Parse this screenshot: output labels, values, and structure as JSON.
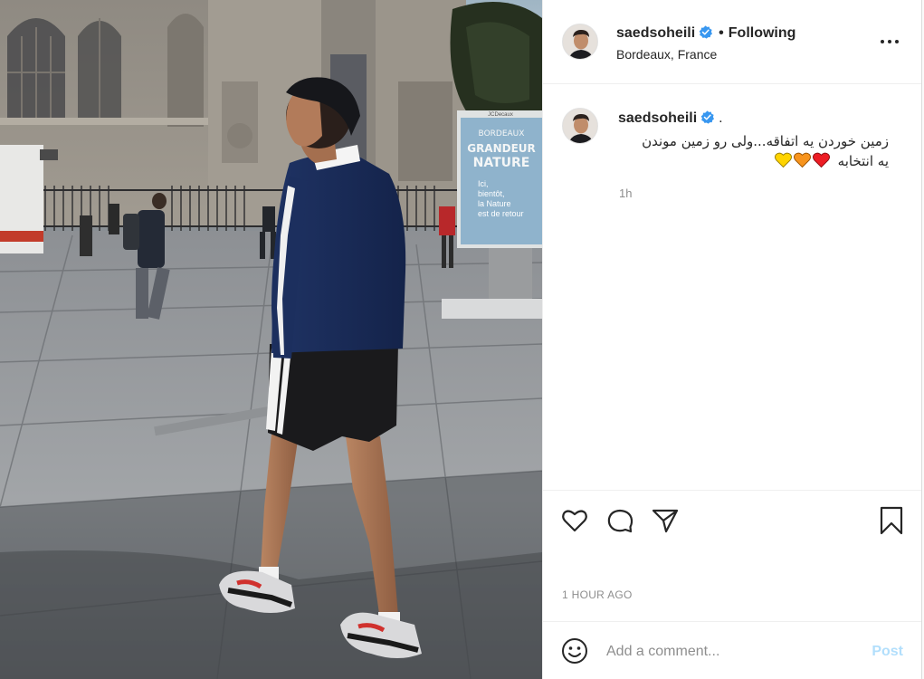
{
  "header": {
    "username": "saedsoheili",
    "separator": "•",
    "follow_status": "Following",
    "location": "Bordeaux, France"
  },
  "caption": {
    "username": "saedsoheili",
    "trailing": ".",
    "line1": "زمین خوردن یه اتفاقه...ولی رو زمین موندن",
    "line2": "یه انتخابه",
    "emojis": [
      "red-heart",
      "orange-heart",
      "yellow-heart"
    ],
    "time": "1h"
  },
  "photo": {
    "sign_lines": [
      "BORDEAUX",
      "GRANDEUR",
      "NATURE",
      "Ici,",
      "bientôt,",
      "la Nature",
      "est de retour"
    ],
    "sign_brand": "JCDecaux"
  },
  "actions": {
    "like_icon": "heart-outline-icon",
    "comment_icon": "comment-bubble-icon",
    "share_icon": "paper-plane-icon",
    "save_icon": "bookmark-icon"
  },
  "timestamp": "1 HOUR AGO",
  "comment": {
    "placeholder": "Add a comment...",
    "post_label": "Post"
  },
  "colors": {
    "verified": "#3897f0",
    "post_disabled": "#b2dffc",
    "muted_text": "#8e8e8e",
    "red_heart": "#ed1c24",
    "orange_heart": "#f7941d",
    "yellow_heart": "#ffd400"
  }
}
